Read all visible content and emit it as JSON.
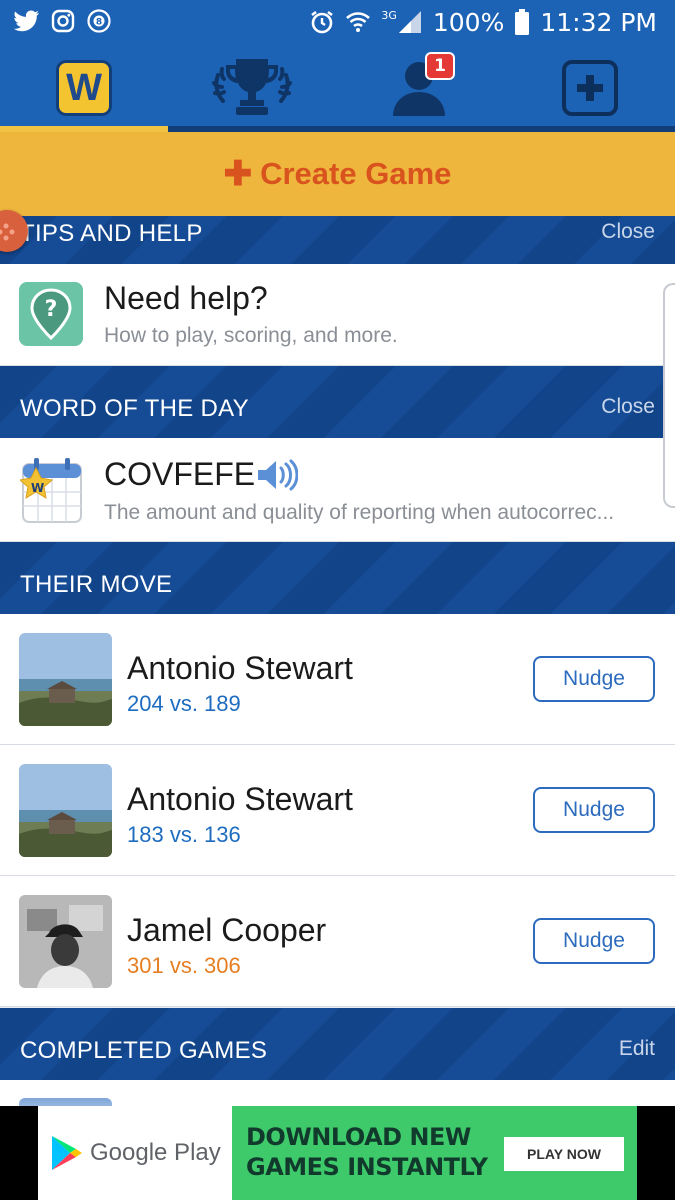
{
  "status_bar": {
    "network_label": "3G",
    "battery": "100%",
    "time": "11:32 PM"
  },
  "nav": {
    "logo_letter": "W",
    "notification_count": "1"
  },
  "create_game": {
    "label": "Create Game"
  },
  "tips": {
    "header": "TIPS AND HELP",
    "close_label": "Close",
    "title": "Need help?",
    "subtitle": "How to play, scoring, and more."
  },
  "word_of_day": {
    "header": "WORD OF THE DAY",
    "close_label": "Close",
    "word": "COVFEFE",
    "definition": "The amount and quality of reporting when autocorrec...",
    "calendar_badge": "W"
  },
  "their_move": {
    "header": "THEIR MOVE",
    "games": [
      {
        "name": "Antonio Stewart",
        "score": "204 vs. 189",
        "score_color": "#1e6cc0",
        "action": "Nudge"
      },
      {
        "name": "Antonio Stewart",
        "score": "183 vs. 136",
        "score_color": "#1e6cc0",
        "action": "Nudge"
      },
      {
        "name": "Jamel Cooper",
        "score": "301 vs. 306",
        "score_color": "#e67e22",
        "action": "Nudge"
      }
    ]
  },
  "completed": {
    "header": "COMPLETED GAMES",
    "edit_label": "Edit"
  },
  "ad": {
    "store_name": "Google Play",
    "headline_line1": "DOWNLOAD NEW",
    "headline_line2": "GAMES INSTANTLY",
    "cta": "PLAY NOW"
  },
  "colors": {
    "primary_blue": "#1d63b5",
    "header_navy": "#12448a",
    "create_yellow": "#efb63d",
    "create_text": "#d9531e",
    "ad_green": "#3ec96b"
  }
}
